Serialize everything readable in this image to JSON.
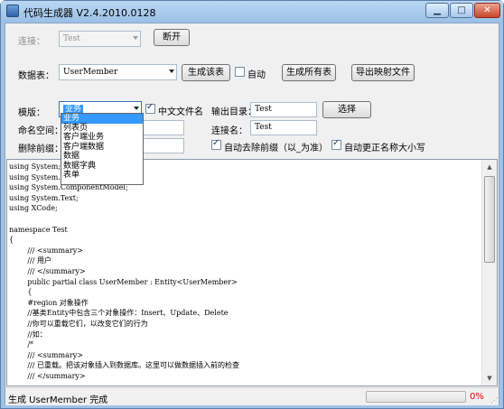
{
  "window": {
    "title": "代码生成器 V2.4.2010.0128"
  },
  "connection": {
    "label": "连接：",
    "value": "Test",
    "disconnect_label": "断开"
  },
  "table_row": {
    "label": "数据表：",
    "value": "UserMember",
    "generate_table_label": "生成该表",
    "auto_label": "自动",
    "auto_checked": false,
    "generate_all_label": "生成所有表",
    "export_map_label": "导出映射文件"
  },
  "template_row": {
    "label": "模版：",
    "value": "业务",
    "chinese_filename_label": "中文文件名",
    "chinese_filename_checked": true,
    "output_dir_label": "输出目录：",
    "output_dir_value": "Test",
    "select_label": "选择"
  },
  "namespace_row": {
    "label": "命名空间：",
    "connection_name_label": "连接名：",
    "connection_name_value": "Test"
  },
  "prefix_row": {
    "label": "删除前缀：",
    "auto_remove_prefix_label": "自动去除前缀（以_为准）",
    "auto_remove_prefix_checked": true,
    "auto_correct_case_label": "自动更正名称大小写",
    "auto_correct_case_checked": true
  },
  "template_dropdown": {
    "options": [
      "业务",
      "列表页",
      "客户端业务",
      "客户端数据",
      "数据",
      "数据字典",
      "表单"
    ],
    "selected_index": 0
  },
  "code_lines": [
    "using System;",
    "using System.Collections.Generic;",
    "using System.ComponentModel;",
    "using System.Text;",
    "using XCode;",
    "",
    "namespace Test",
    "{",
    "        /// <summary>",
    "        /// 用户",
    "        /// </summary>",
    "        public partial class UserMember : Entity<UserMember>",
    "        {",
    "        #region 对象操作",
    "        //基类Entity中包含三个对象操作：Insert、Update、Delete",
    "        //你可以重载它们，以改变它们的行为",
    "        //如：",
    "        /*",
    "        /// <summary>",
    "        /// 已重载。把该对象插入到数据库。这里可以做数据插入前的检查",
    "        /// </summary>"
  ],
  "status": {
    "message": "生成 UserMember 完成",
    "progress_percent": 0,
    "progress_label": "0%"
  },
  "colors": {
    "selection": "#3399ff",
    "progress_label": "#e00000",
    "title_bar": "#b9d7f3"
  }
}
